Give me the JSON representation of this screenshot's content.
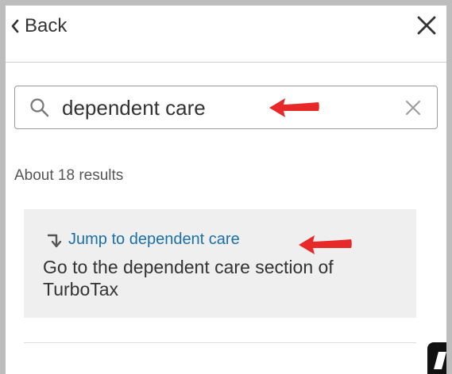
{
  "header": {
    "back_label": "Back",
    "back_icon": "chevron-left-icon",
    "close_icon": "close-icon"
  },
  "search": {
    "value": "dependent care",
    "search_icon": "search-icon",
    "clear_icon": "clear-icon"
  },
  "results": {
    "count_label": "About 18 results",
    "items": [
      {
        "link_label": "Jump to dependent care",
        "icon": "jump-arrow-icon",
        "description": "Go to the dependent care section of TurboTax"
      }
    ]
  },
  "colors": {
    "link": "#1b6fa8",
    "card_bg": "#efefef",
    "annotation_arrow": "#e8292a"
  }
}
